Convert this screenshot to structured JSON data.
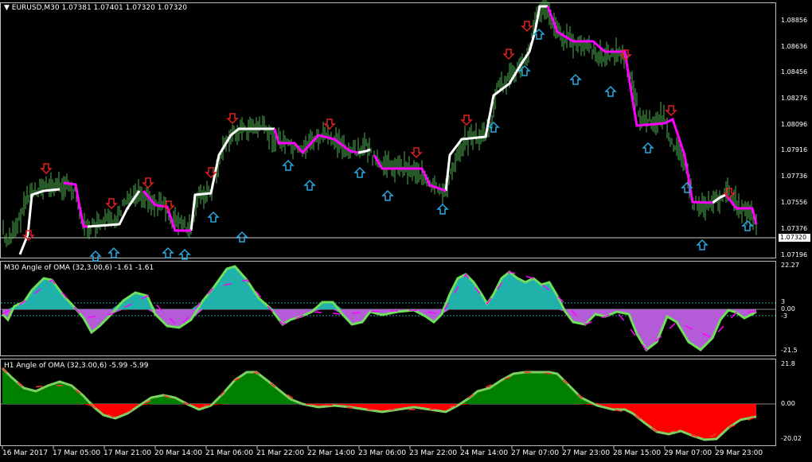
{
  "main": {
    "title": "▼ EURUSD,M30  1.07381 1.07401 1.07320 1.07320",
    "price_ticks": [
      "1.08856",
      "1.08636",
      "1.08456",
      "1.08276",
      "1.08096",
      "1.07916",
      "1.07736",
      "1.07556",
      "1.07376",
      "1.07196"
    ],
    "current_price": "1.07320"
  },
  "m30": {
    "title": "M30 Angle of OMA (32,3.00,6) -1.61 -1.61",
    "ticks": [
      "22.27",
      "3",
      "0.00",
      "-3",
      "-21.5"
    ]
  },
  "h1": {
    "title": "H1 Angle of OMA (32,3.00,6) -5.99 -5.99",
    "ticks": [
      "21.8",
      "0.00",
      "-20.02"
    ]
  },
  "x_axis": {
    "dates": [
      "16 Mar 2017",
      "17 Mar 05:00",
      "17 Mar 21:00",
      "20 Mar 14:00",
      "21 Mar 06:00",
      "21 Mar 22:00",
      "22 Mar 14:00",
      "23 Mar 06:00",
      "23 Mar 22:00",
      "24 Mar 14:00",
      "27 Mar 07:00",
      "27 Mar 23:00",
      "28 Mar 15:00",
      "29 Mar 07:00",
      "29 Mar 23:00"
    ]
  },
  "colors": {
    "background": "#000000",
    "frame": "#bdbdbd",
    "bars": "#4caf50",
    "oma_up": "#ffffff",
    "oma_down": "#ff00ff",
    "arrow_down": "#e02020",
    "arrow_up": "#2aa8e0",
    "m30_pos_fill": "#20b2aa",
    "m30_neg_fill": "#b45cd8",
    "h1_pos_fill": "#008000",
    "h1_neg_fill": "#ff0000",
    "level_line": "#2aa8a8"
  },
  "icons": {
    "arrow_down": "down-arrow-icon",
    "arrow_up": "up-arrow-icon",
    "menu": "triangle-down-icon"
  }
}
